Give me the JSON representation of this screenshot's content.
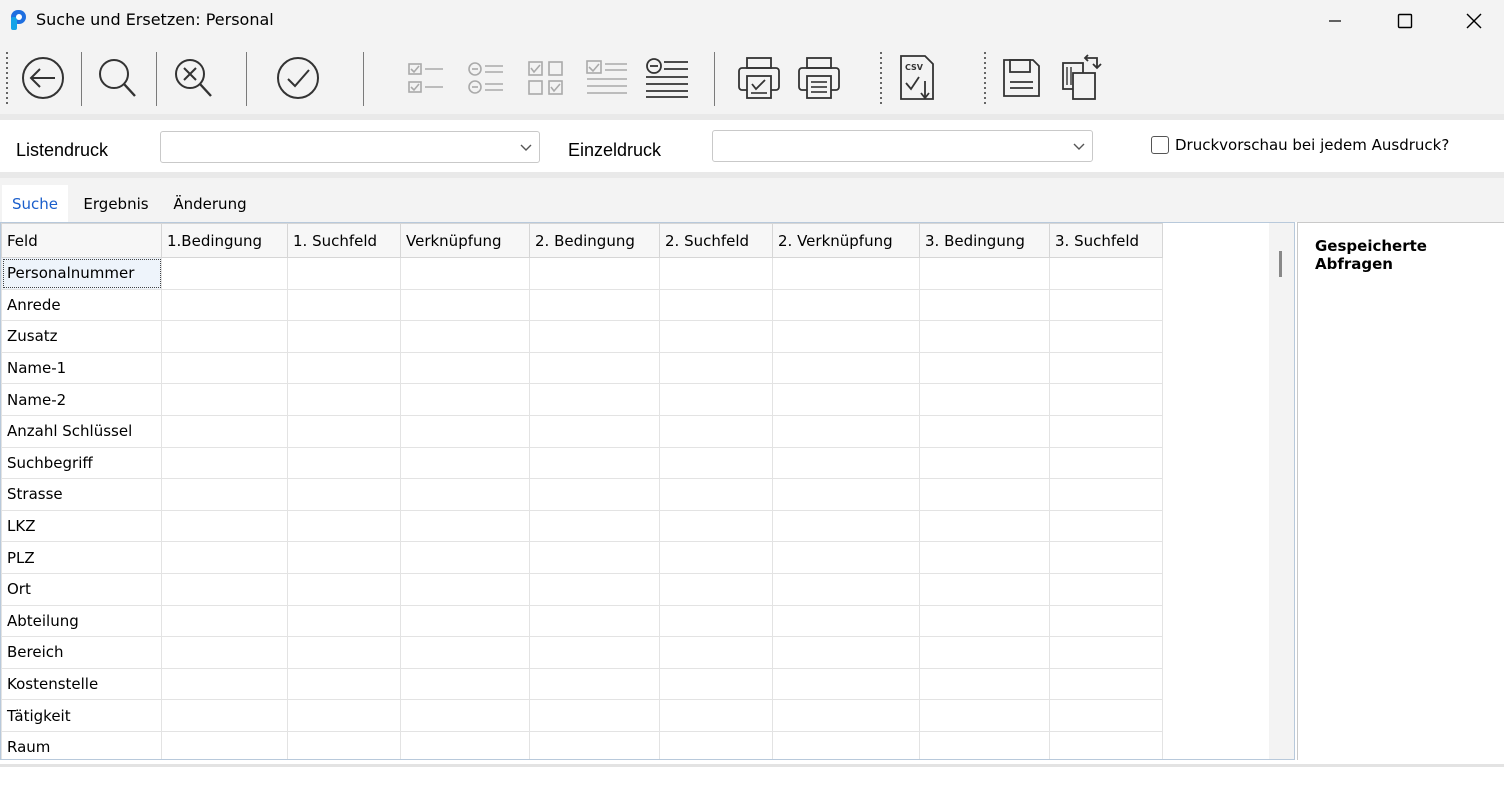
{
  "window": {
    "title": "Suche und Ersetzen: Personal",
    "accent": "#1a5ecb"
  },
  "toolbar": {
    "buttons": [
      {
        "name": "back-icon",
        "enabled": true
      },
      {
        "name": "search-icon",
        "enabled": true
      },
      {
        "name": "clear-search-icon",
        "enabled": true
      },
      {
        "name": "confirm-icon",
        "enabled": true
      },
      {
        "name": "select-all-icon",
        "enabled": false
      },
      {
        "name": "deselect-all-icon",
        "enabled": false
      },
      {
        "name": "toggle-selection-icon",
        "enabled": false
      },
      {
        "name": "list-selection-icon",
        "enabled": false
      },
      {
        "name": "list-icon",
        "enabled": true
      },
      {
        "name": "print-list-icon",
        "enabled": true
      },
      {
        "name": "print-icon",
        "enabled": true
      },
      {
        "name": "csv-export-icon",
        "enabled": true
      },
      {
        "name": "save-icon",
        "enabled": true
      },
      {
        "name": "copy-transfer-icon",
        "enabled": true
      }
    ]
  },
  "print": {
    "list_label": "Listendruck",
    "single_label": "Einzeldruck",
    "list_value": "",
    "single_value": "",
    "preview_label": "Druckvorschau bei jedem Ausdruck?",
    "preview_checked": false
  },
  "tabs": [
    {
      "label": "Suche",
      "active": true
    },
    {
      "label": "Ergebnis",
      "active": false
    },
    {
      "label": "Änderung",
      "active": false
    }
  ],
  "grid": {
    "columns": [
      "Feld",
      "1.Bedingung",
      "1. Suchfeld",
      "Verknüpfung",
      "2. Bedingung",
      "2. Suchfeld",
      "2. Verknüpfung",
      "3. Bedingung",
      "3. Suchfeld"
    ],
    "rows": [
      "Personalnummer",
      "Anrede",
      "Zusatz",
      "Name-1",
      "Name-2",
      "Anzahl Schlüssel",
      "Suchbegriff",
      "Strasse",
      "LKZ",
      "PLZ",
      "Ort",
      "Abteilung",
      "Bereich",
      "Kostenstelle",
      "Tätigkeit",
      "Raum"
    ]
  },
  "saved": {
    "title": "Gespeicherte Abfragen"
  }
}
